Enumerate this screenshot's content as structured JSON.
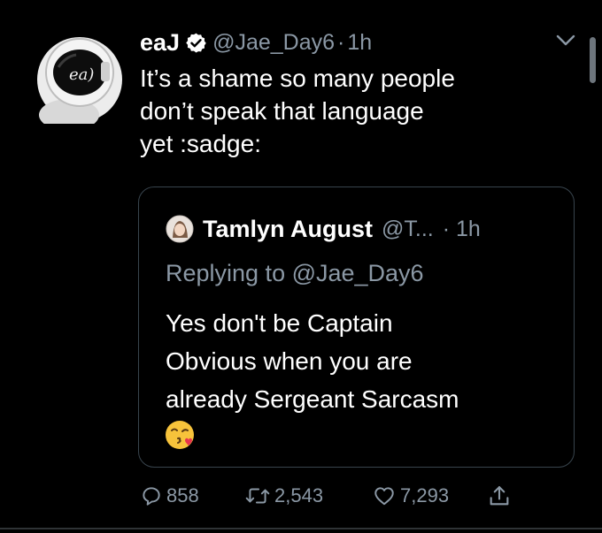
{
  "tweet": {
    "author_name": "eaJ",
    "author_handle": "@Jae_Day6",
    "separator": "·",
    "time": "1h",
    "text": "It’s a shame so many people\ndon’t speak that language\nyet :sadge:",
    "avatar_lettering": "ea)"
  },
  "quote": {
    "author_name": "Tamlyn August",
    "author_handle": "@T...",
    "separator_time": "· 1h",
    "replying_to": "Replying to @Jae_Day6",
    "text": "Yes don't be Captain\nObvious when you are\nalready Sergeant Sarcasm",
    "emoji": "kissing-face-with-heart"
  },
  "actions": {
    "replies": "858",
    "retweets": "2,543",
    "likes": "7,293"
  },
  "icons": {
    "verified": "verified-badge-icon",
    "menu": "chevron-down-icon",
    "reply": "reply-icon",
    "retweet": "retweet-icon",
    "like": "heart-icon",
    "share": "share-icon"
  },
  "colors": {
    "background": "#000000",
    "text_primary": "#ffffff",
    "text_secondary": "#8b98a5",
    "border": "#38444d"
  }
}
